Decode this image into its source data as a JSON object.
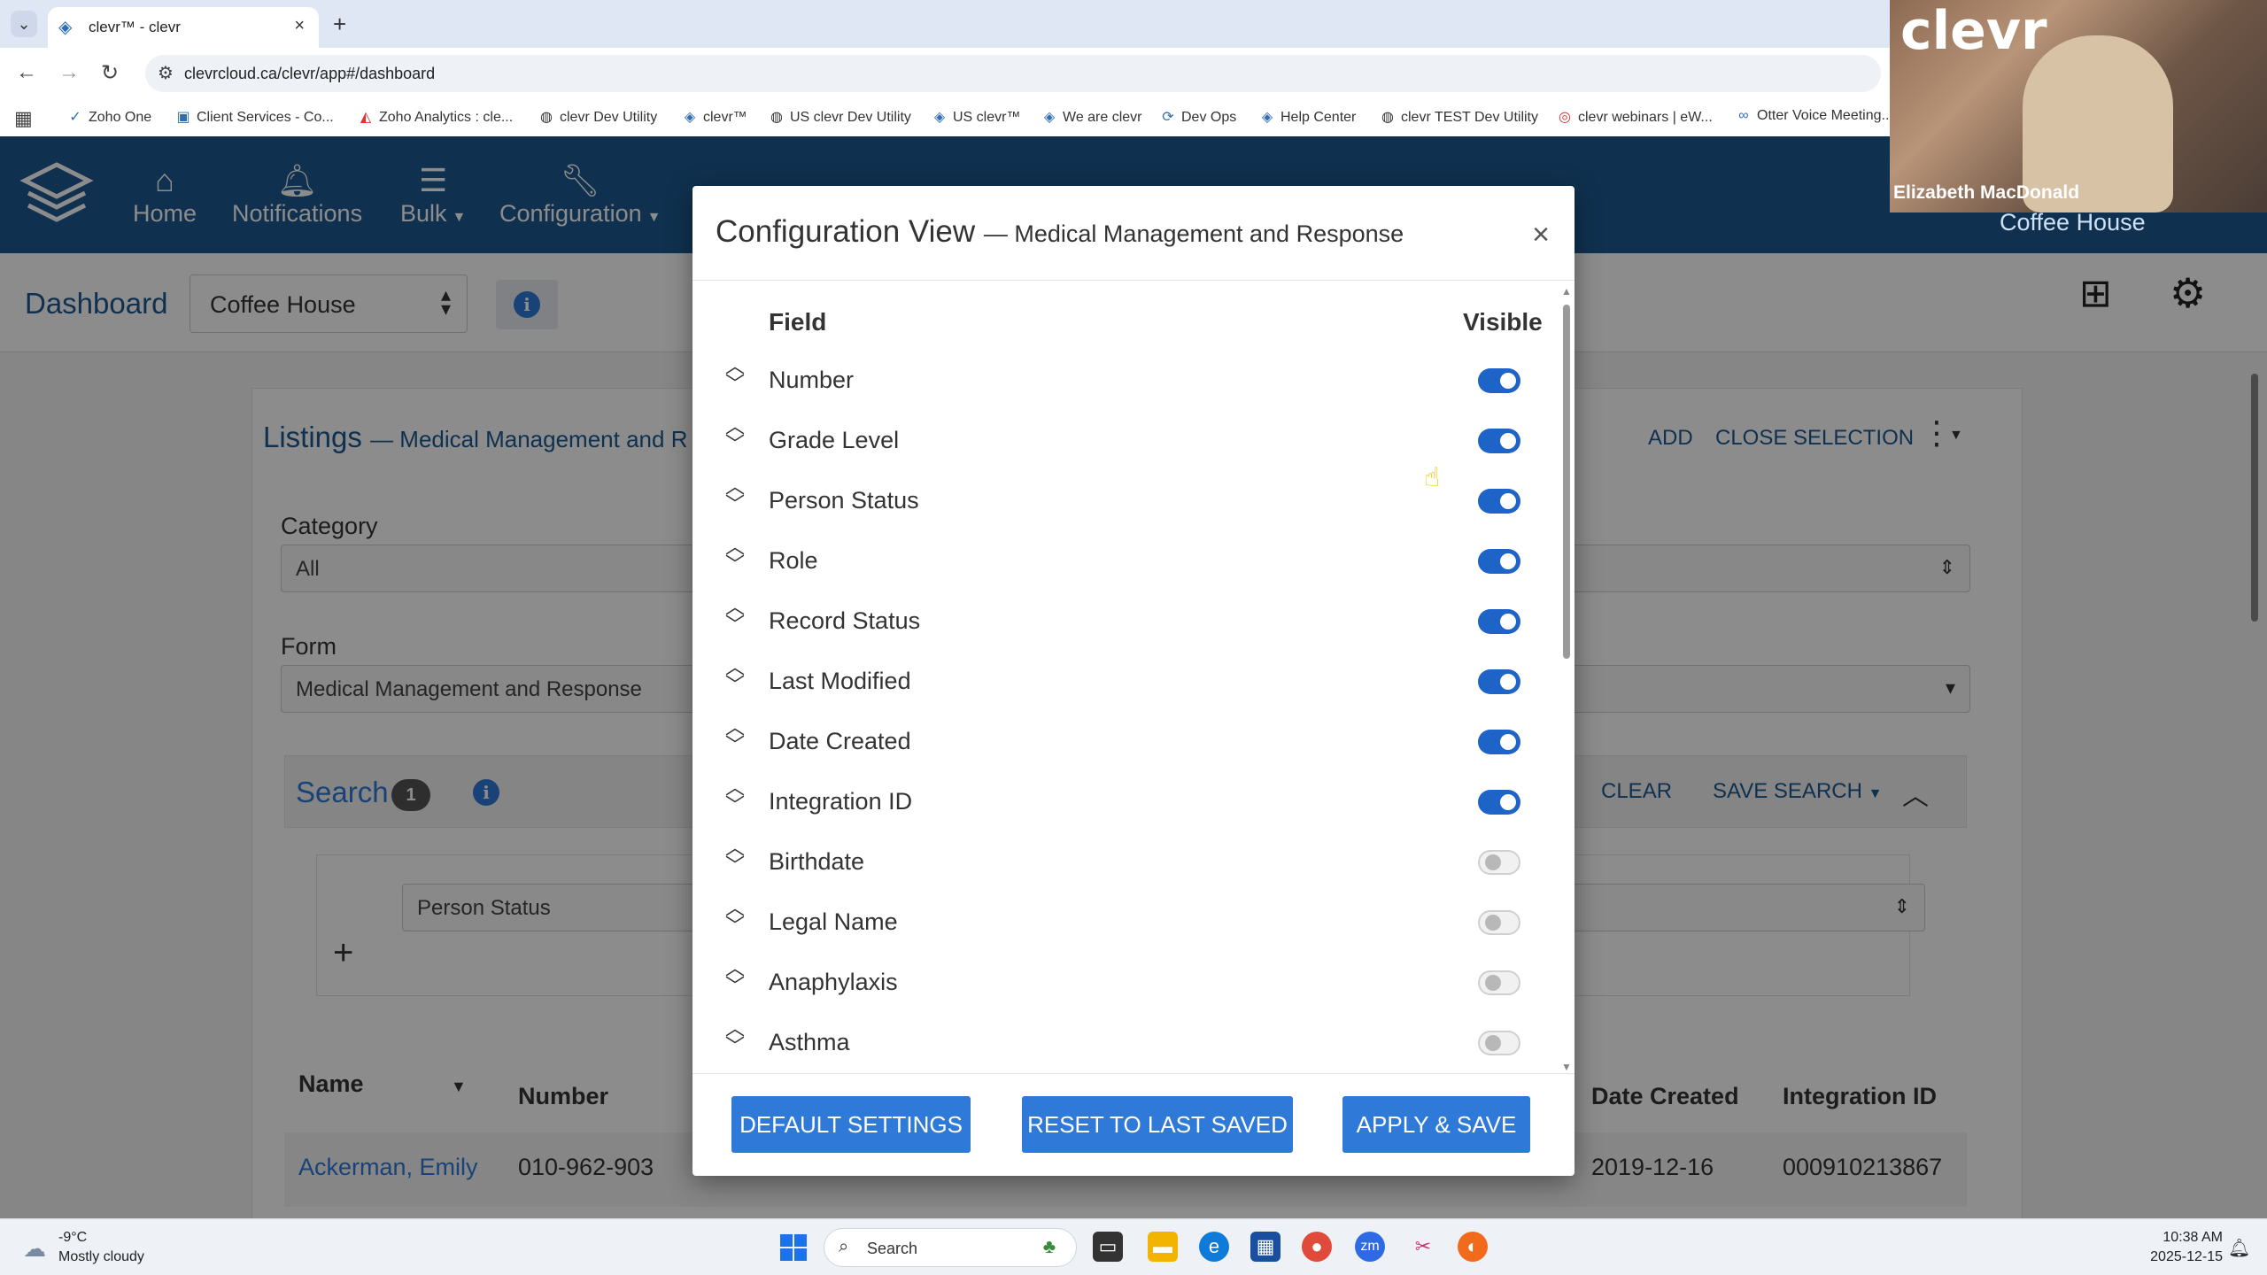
{
  "browser": {
    "tab_title": "clevr™ - clevr",
    "url": "clevrcloud.ca/clevr/app#/dashboard",
    "bookmarks": [
      {
        "label": "Zoho One",
        "icon": "zoho-icon"
      },
      {
        "label": "Client Services - Co...",
        "icon": "document-icon"
      },
      {
        "label": "Zoho Analytics : cle...",
        "icon": "analytics-icon"
      },
      {
        "label": "clevr Dev Utility",
        "icon": "globe-icon"
      },
      {
        "label": "clevr™",
        "icon": "clevr-icon"
      },
      {
        "label": "US clevr Dev Utility",
        "icon": "globe-icon"
      },
      {
        "label": "US clevr™",
        "icon": "clevr-icon"
      },
      {
        "label": "We are clevr",
        "icon": "clevr-icon"
      },
      {
        "label": "Dev Ops",
        "icon": "sync-icon"
      },
      {
        "label": "Help Center",
        "icon": "clevr-icon"
      },
      {
        "label": "clevr TEST Dev Utility",
        "icon": "globe-icon"
      },
      {
        "label": "clevr webinars | eW...",
        "icon": "webinar-icon"
      },
      {
        "label": "Otter Voice Meeting...",
        "icon": "otter-icon"
      }
    ]
  },
  "nav": {
    "items": [
      {
        "label": "Home",
        "icon": "home-icon"
      },
      {
        "label": "Notifications",
        "icon": "bell-icon"
      },
      {
        "label": "Bulk",
        "icon": "list-icon",
        "dropdown": true
      },
      {
        "label": "Configuration",
        "icon": "wrench-icon",
        "dropdown": true
      }
    ]
  },
  "dashboard": {
    "title": "Dashboard",
    "selected_location": "Coffee House"
  },
  "listings": {
    "title": "Listings",
    "subtitle": "— Medical Management and R",
    "actions": {
      "add": "ADD",
      "close_selection": "CLOSE SELECTION"
    },
    "category_label": "Category",
    "category_value": "All",
    "form_label": "Form",
    "form_value": "Medical Management and Response",
    "search_title": "Search",
    "search_count": "1",
    "search_clear": "CLEAR",
    "search_save": "SAVE SEARCH",
    "search_field": "Person Status",
    "table": {
      "headers": [
        "Name",
        "Number",
        "Date Created",
        "Integration ID"
      ],
      "rows": [
        {
          "name": "Ackerman, Emily",
          "number": "010-962-903",
          "date_created": "2019-12-16",
          "integration_id": "000910213867"
        }
      ]
    }
  },
  "modal": {
    "title": "Configuration View",
    "subtitle": "— Medical Management and Response",
    "col_field": "Field",
    "col_visible": "Visible",
    "fields": [
      {
        "name": "Number",
        "visible": true
      },
      {
        "name": "Grade Level",
        "visible": true
      },
      {
        "name": "Person Status",
        "visible": true
      },
      {
        "name": "Role",
        "visible": true
      },
      {
        "name": "Record Status",
        "visible": true
      },
      {
        "name": "Last Modified",
        "visible": true
      },
      {
        "name": "Date Created",
        "visible": true
      },
      {
        "name": "Integration ID",
        "visible": true
      },
      {
        "name": "Birthdate",
        "visible": false
      },
      {
        "name": "Legal Name",
        "visible": false
      },
      {
        "name": "Anaphylaxis",
        "visible": false
      },
      {
        "name": "Asthma",
        "visible": false
      }
    ],
    "buttons": {
      "default": "DEFAULT SETTINGS",
      "reset": "RESET TO LAST SAVED",
      "apply": "APPLY & SAVE"
    }
  },
  "webcam": {
    "brand": "clevr",
    "participant": "Elizabeth MacDonald",
    "location_label": "Coffee House"
  },
  "taskbar": {
    "temperature": "-9°C",
    "weather": "Mostly cloudy",
    "search_placeholder": "Search",
    "time": "10:38 AM",
    "date": "2025-12-15"
  },
  "colors": {
    "nav_bg": "#1c5a91",
    "accent": "#2f7ad8",
    "toggle_on": "#1e63c7"
  }
}
